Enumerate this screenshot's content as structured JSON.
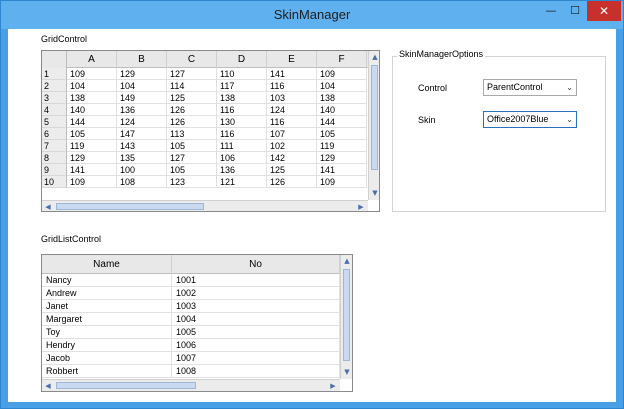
{
  "window": {
    "title": "SkinManager",
    "minimize_glyph": "—",
    "maximize_glyph": "☐",
    "close_glyph": "✕"
  },
  "grid_control": {
    "label": "GridControl",
    "columns": [
      "A",
      "B",
      "C",
      "D",
      "E",
      "F"
    ],
    "rows": [
      {
        "h": "1",
        "cells": [
          "109",
          "129",
          "127",
          "110",
          "141",
          "109"
        ]
      },
      {
        "h": "2",
        "cells": [
          "104",
          "104",
          "114",
          "117",
          "116",
          "104"
        ]
      },
      {
        "h": "3",
        "cells": [
          "138",
          "149",
          "125",
          "138",
          "103",
          "138"
        ]
      },
      {
        "h": "4",
        "cells": [
          "140",
          "136",
          "126",
          "116",
          "124",
          "140"
        ]
      },
      {
        "h": "5",
        "cells": [
          "144",
          "124",
          "126",
          "130",
          "116",
          "144"
        ]
      },
      {
        "h": "6",
        "cells": [
          "105",
          "147",
          "113",
          "116",
          "107",
          "105"
        ]
      },
      {
        "h": "7",
        "cells": [
          "119",
          "143",
          "105",
          "111",
          "102",
          "119"
        ]
      },
      {
        "h": "8",
        "cells": [
          "129",
          "135",
          "127",
          "106",
          "142",
          "129"
        ]
      },
      {
        "h": "9",
        "cells": [
          "141",
          "100",
          "105",
          "136",
          "125",
          "141"
        ]
      },
      {
        "h": "10",
        "cells": [
          "109",
          "108",
          "123",
          "121",
          "126",
          "109"
        ]
      }
    ]
  },
  "options": {
    "title": "SkinManagerOptions",
    "control_label": "Control",
    "control_value": "ParentControl",
    "skin_label": "Skin",
    "skin_value": "Office2007Blue"
  },
  "grid_list_control": {
    "label": "GridListControl",
    "columns": [
      "Name",
      "No"
    ],
    "rows": [
      {
        "name": "Nancy",
        "no": "1001"
      },
      {
        "name": "Andrew",
        "no": "1002"
      },
      {
        "name": "Janet",
        "no": "1003"
      },
      {
        "name": "Margaret",
        "no": "1004"
      },
      {
        "name": "Toy",
        "no": "1005"
      },
      {
        "name": "Hendry",
        "no": "1006"
      },
      {
        "name": "Jacob",
        "no": "1007"
      },
      {
        "name": "Robbert",
        "no": "1008"
      }
    ]
  },
  "icons": {
    "scroll_up": "▲",
    "scroll_down": "▼",
    "scroll_left": "◀",
    "scroll_right": "▶",
    "dropdown": "⌄"
  },
  "colors": {
    "title_bar": "#5fb0ee",
    "close_button": "#c7302b",
    "focus_border": "#2c70b8"
  }
}
